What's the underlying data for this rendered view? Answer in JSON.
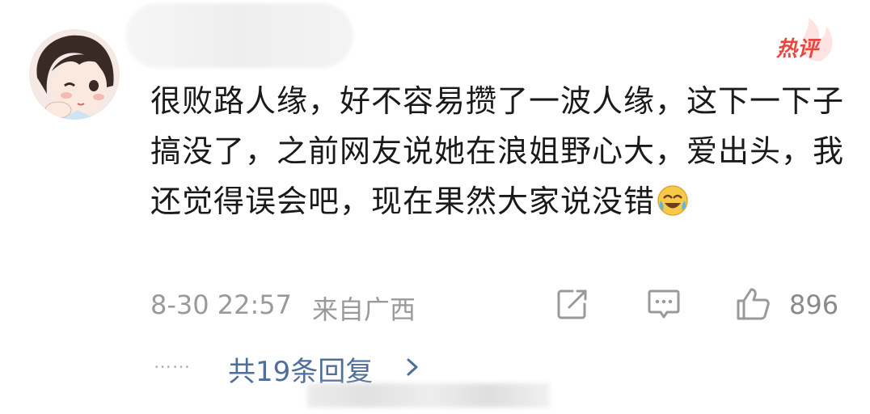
{
  "comment": {
    "text": "很败路人缘，好不容易攒了一波人缘，这下一下子搞没了，之前网友说她在浪姐野心大，爱出头，我还觉得误会吧，现在果然大家说没错",
    "emoji": "laughing-crying-emoji"
  },
  "badge": {
    "label": "热评",
    "color": "#e8473f"
  },
  "meta": {
    "time": "8-30 22:57",
    "location": "来自广西",
    "like_count": "896"
  },
  "icons": {
    "share": "share-icon",
    "comment": "comment-icon",
    "like": "like-icon",
    "chevron": "chevron-right-icon"
  },
  "replies": {
    "dots": "……",
    "label": "共19条回复"
  },
  "colors": {
    "text": "#1a1a1a",
    "meta": "#9a9a9a",
    "link": "#4f6e9a",
    "hot": "#e8473f"
  }
}
